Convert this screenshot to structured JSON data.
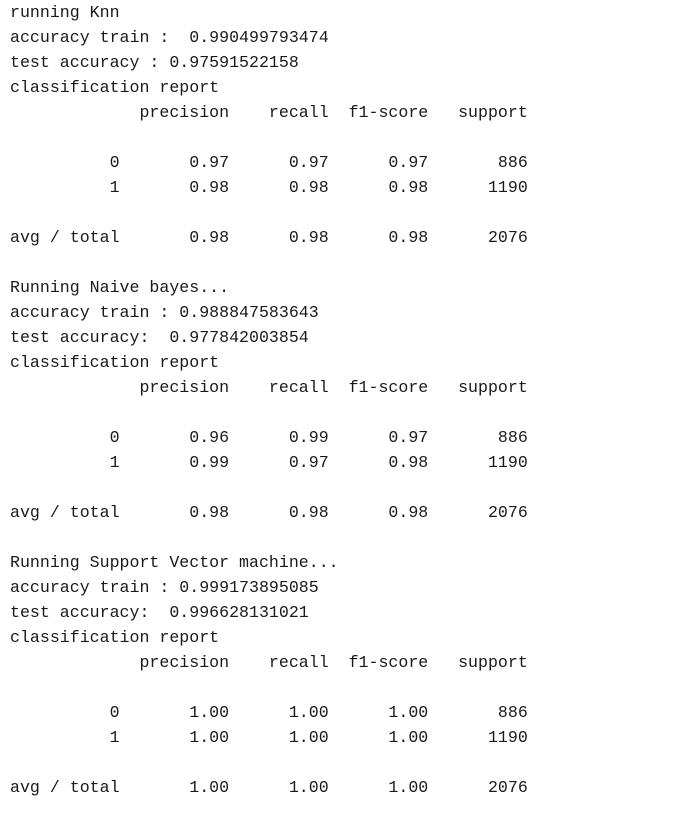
{
  "output": {
    "lines": [
      "running Knn",
      "accuracy train :  0.990499793474",
      "test accuracy : 0.97591522158",
      "classification report",
      "             precision    recall  f1-score   support",
      "",
      "          0       0.97      0.97      0.97       886",
      "          1       0.98      0.98      0.98      1190",
      "",
      "avg / total       0.98      0.98      0.98      2076",
      "",
      "Running Naive bayes...",
      "accuracy train : 0.988847583643",
      "test accuracy:  0.977842003854",
      "classification report",
      "             precision    recall  f1-score   support",
      "",
      "          0       0.96      0.99      0.97       886",
      "          1       0.99      0.97      0.98      1190",
      "",
      "avg / total       0.98      0.98      0.98      2076",
      "",
      "Running Support Vector machine...",
      "accuracy train : 0.999173895085",
      "test accuracy:  0.996628131021",
      "classification report",
      "             precision    recall  f1-score   support",
      "",
      "          0       1.00      1.00      1.00       886",
      "          1       1.00      1.00      1.00      1190",
      "",
      "avg / total       1.00      1.00      1.00      2076"
    ]
  }
}
